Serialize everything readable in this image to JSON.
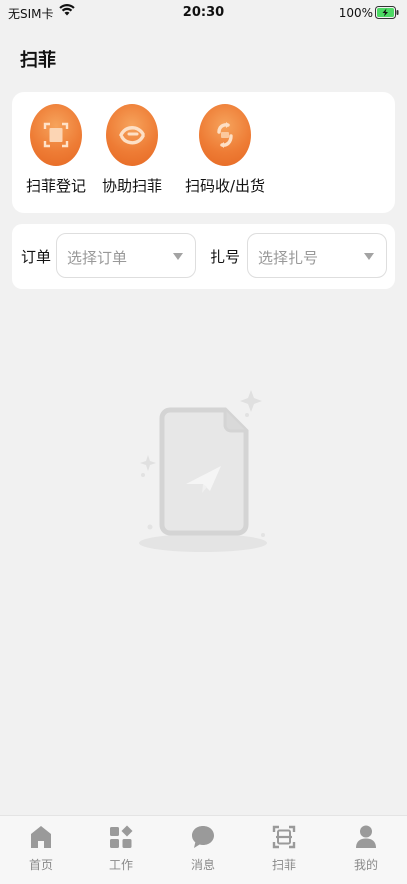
{
  "status_bar": {
    "carrier": "无SIM卡",
    "time": "20:30",
    "battery": "100%"
  },
  "page": {
    "title": "扫菲"
  },
  "actions": [
    {
      "label": "扫菲登记",
      "icon": "scan-frame-icon"
    },
    {
      "label": "协助扫菲",
      "icon": "handshake-icon"
    },
    {
      "label": "扫码收/出货",
      "icon": "transfer-arrows-icon"
    }
  ],
  "filters": {
    "order": {
      "label": "订单",
      "placeholder": "选择订单"
    },
    "bundle": {
      "label": "扎号",
      "placeholder": "选择扎号"
    }
  },
  "tabs": [
    {
      "label": "首页",
      "icon": "home-icon"
    },
    {
      "label": "工作",
      "icon": "apps-icon"
    },
    {
      "label": "消息",
      "icon": "message-icon"
    },
    {
      "label": "扫菲",
      "icon": "scan-icon"
    },
    {
      "label": "我的",
      "icon": "user-icon"
    }
  ],
  "colors": {
    "accent_gradient_start": "#f6a35c",
    "accent_gradient_end": "#e56823",
    "tab_inactive": "#8a8a8a"
  }
}
